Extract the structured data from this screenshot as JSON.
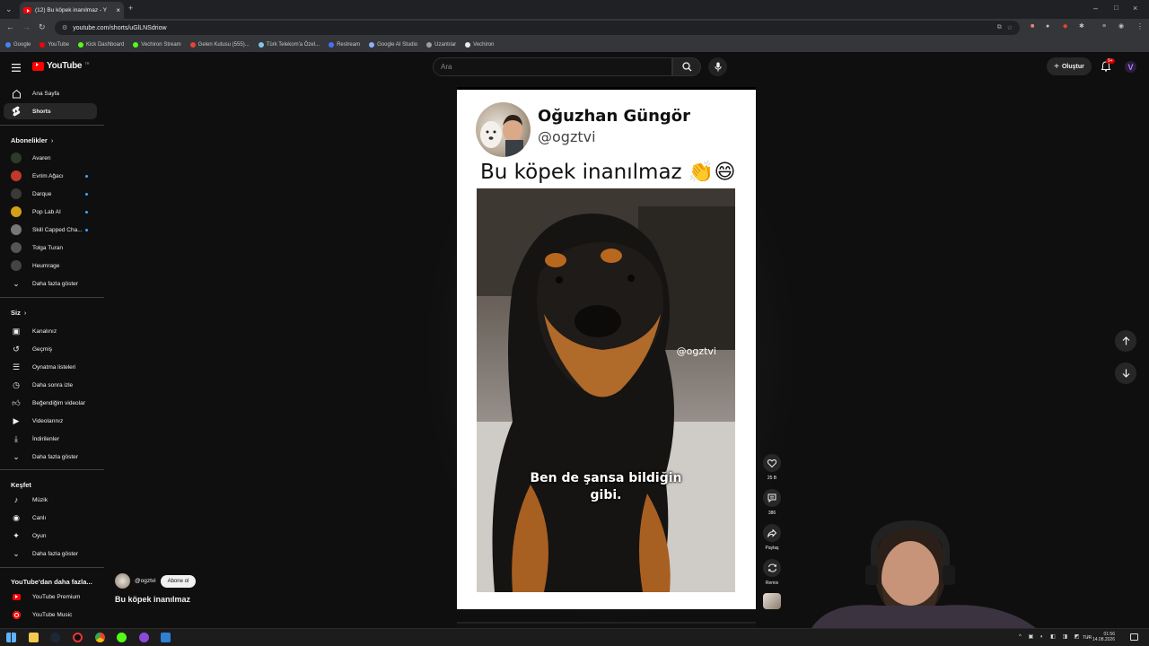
{
  "browser": {
    "tab_title": "(12) Bu köpek inanılmaz - Y",
    "url": "youtube.com/shorts/uGlLNSdriow",
    "bookmarks": [
      {
        "label": "Google",
        "color": "#4285f4"
      },
      {
        "label": "YouTube",
        "color": "#ff0000"
      },
      {
        "label": "Kick Dashboard",
        "color": "#53fc18"
      },
      {
        "label": "Vechiron Stream",
        "color": "#53fc18"
      },
      {
        "label": "Gelen Kutusu (555)...",
        "color": "#ea4335"
      },
      {
        "label": "Türk Telekom'a Özel...",
        "color": "#7ec8e3"
      },
      {
        "label": "Restream",
        "color": "#4f6ef7"
      },
      {
        "label": "Google AI Studio",
        "color": "#8ab4f8"
      },
      {
        "label": "Uzantılar",
        "color": "#9aa0a6"
      },
      {
        "label": "Vechiron",
        "color": "#e8eaed"
      }
    ]
  },
  "header": {
    "logo_text": "YouTube",
    "logo_region": "TR",
    "search_placeholder": "Ara",
    "create_label": "Oluştur",
    "notif_badge": "9+"
  },
  "sidebar": {
    "home": "Ana Sayfa",
    "shorts": "Shorts",
    "subs_heading": "Abonelikler",
    "subscriptions": [
      {
        "name": "Avaren",
        "color": "#2e3b2a",
        "live": false
      },
      {
        "name": "Evrim Ağacı",
        "color": "#c0392b",
        "live": true
      },
      {
        "name": "Darque",
        "color": "#3a3a3a",
        "live": true
      },
      {
        "name": "Pop Lab AI",
        "color": "#d4a017",
        "live": true
      },
      {
        "name": "Skill Capped Cha...",
        "color": "#777777",
        "live": true
      },
      {
        "name": "Tolga Turan",
        "color": "#555555",
        "live": false
      },
      {
        "name": "Heumrage",
        "color": "#444444",
        "live": false
      }
    ],
    "subs_more": "Daha fazla göster",
    "you_heading": "Siz",
    "you_items": [
      {
        "label": "Kanalınız",
        "icon": "channel-icon"
      },
      {
        "label": "Geçmiş",
        "icon": "history-icon"
      },
      {
        "label": "Oynatma listeleri",
        "icon": "playlist-icon"
      },
      {
        "label": "Daha sonra izle",
        "icon": "clock-icon"
      },
      {
        "label": "Beğendiğim videolar",
        "icon": "thumb-up-icon"
      },
      {
        "label": "Videolarınız",
        "icon": "video-icon"
      },
      {
        "label": "İndirilenler",
        "icon": "download-icon"
      }
    ],
    "you_more": "Daha fazla göster",
    "explore_heading": "Keşfet",
    "explore_items": [
      {
        "label": "Müzik",
        "icon": "music-icon"
      },
      {
        "label": "Canlı",
        "icon": "live-icon"
      },
      {
        "label": "Oyun",
        "icon": "gaming-icon"
      }
    ],
    "explore_more": "Daha fazla göster",
    "more_heading": "YouTube'dan daha fazla...",
    "more_items": [
      {
        "label": "YouTube Premium"
      },
      {
        "label": "YouTube Music"
      }
    ]
  },
  "short": {
    "poster_name": "Oğuzhan Güngör",
    "poster_handle": "@ogztvi",
    "tweet_text": "Bu köpek inanılmaz 👏😄",
    "watermark": "@ogztvi",
    "caption_line1": "Ben de şansa bildiğin",
    "caption_line2": "gibi.",
    "channel": "@ogztvi",
    "subscribe_label": "Abone ol",
    "title": "Bu köpek inanılmaz"
  },
  "actions": {
    "likes": "25 B",
    "comments": "386",
    "share": "Paylaş",
    "remix": "Remix"
  },
  "taskbar": {
    "lang": "TUR",
    "time": "01:56",
    "date": "14.08.2026"
  }
}
